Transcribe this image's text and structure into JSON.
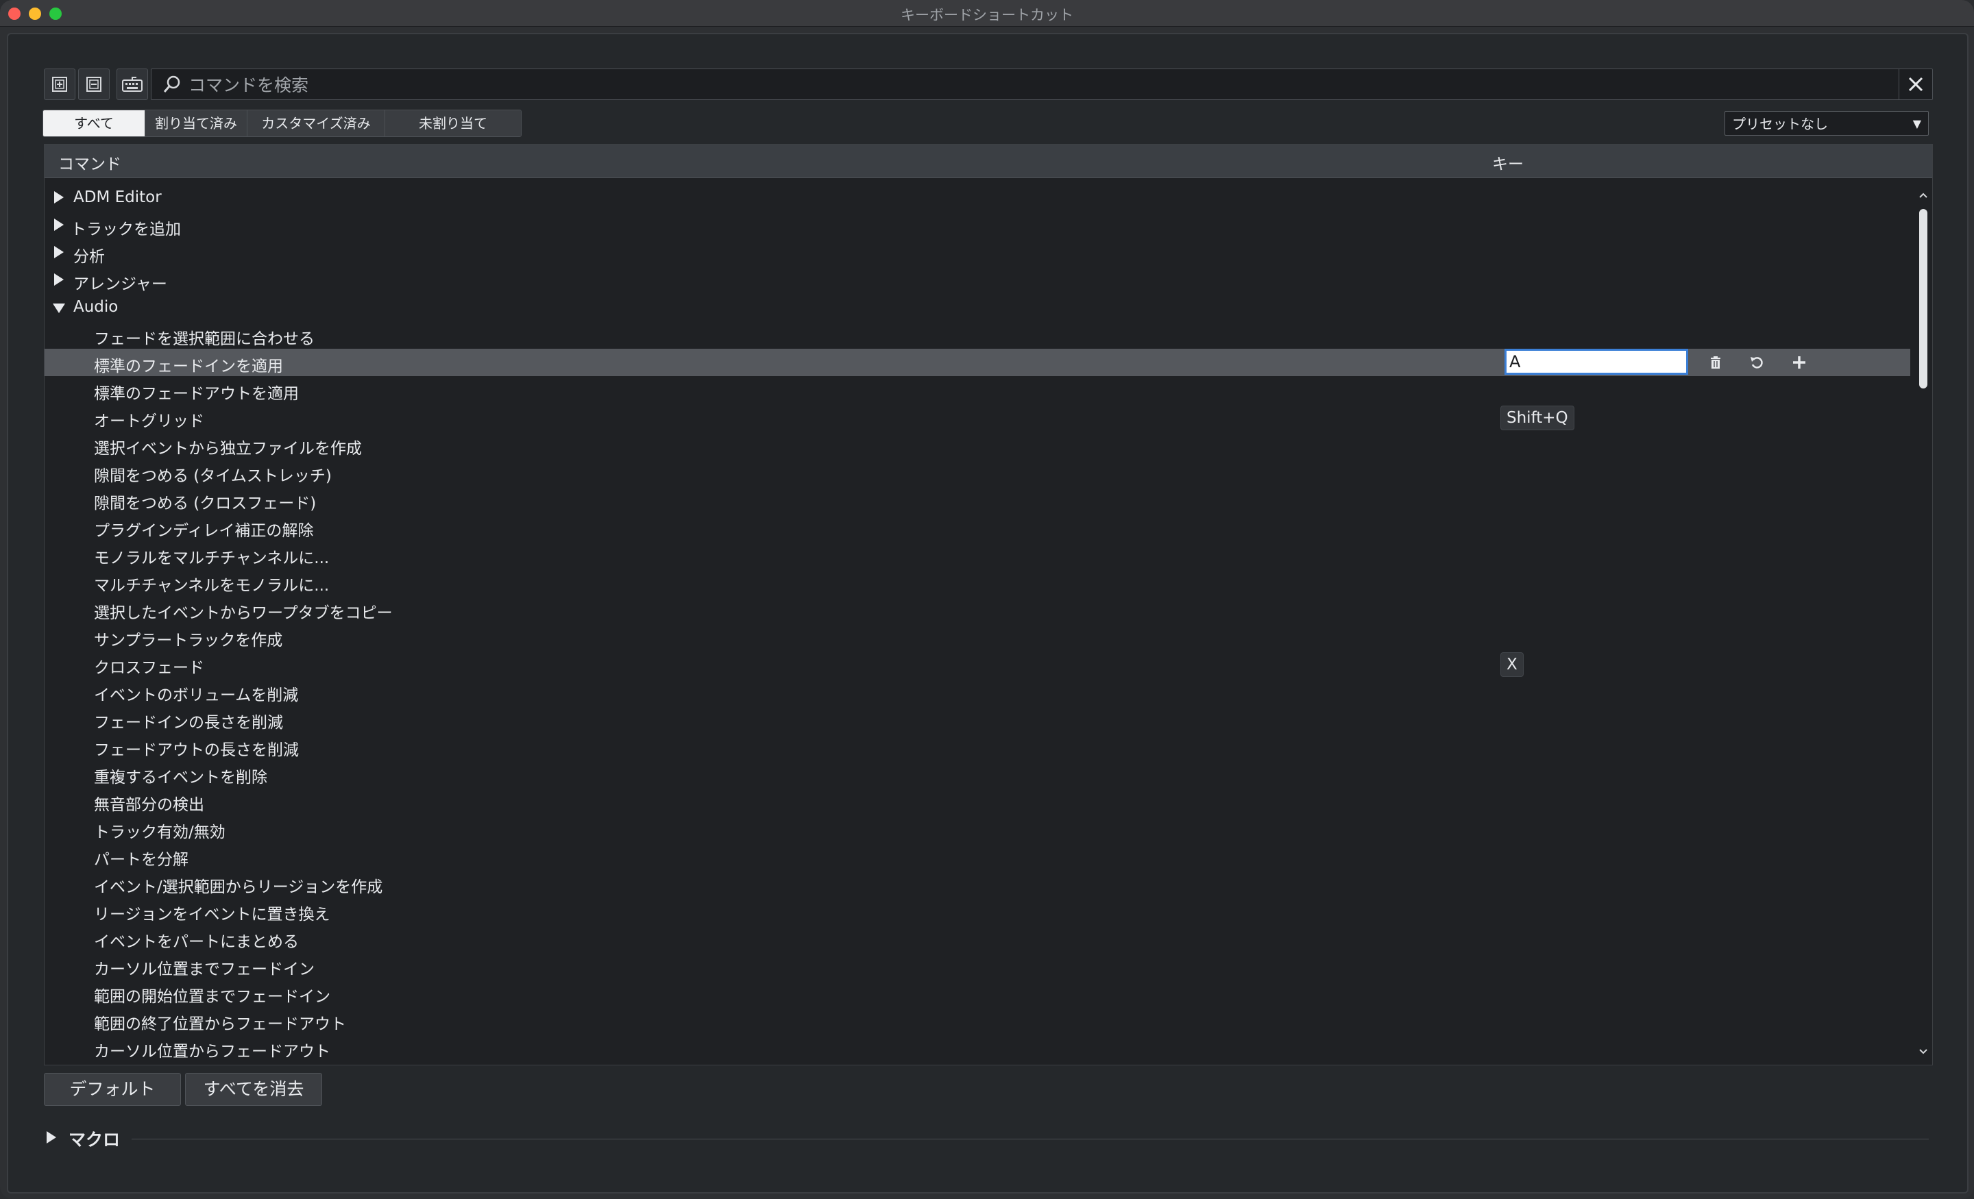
{
  "window": {
    "title": "キーボードショートカット"
  },
  "search": {
    "placeholder": "コマンドを検索",
    "value": ""
  },
  "filters": {
    "tabs": [
      {
        "label": "すべて",
        "active": true
      },
      {
        "label": "割り当て済み",
        "active": false
      },
      {
        "label": "カスタマイズ済み",
        "active": false
      },
      {
        "label": "未割り当て",
        "active": false
      }
    ]
  },
  "preset": {
    "selected": "プリセットなし"
  },
  "table": {
    "headers": {
      "command": "コマンド",
      "key": "キー"
    },
    "rows": [
      {
        "label": "ADM Editor",
        "type": "group",
        "expanded": false
      },
      {
        "label": "トラックを追加",
        "type": "group",
        "expanded": false
      },
      {
        "label": "分析",
        "type": "group",
        "expanded": false
      },
      {
        "label": "アレンジャー",
        "type": "group",
        "expanded": false
      },
      {
        "label": "Audio",
        "type": "group",
        "expanded": true
      },
      {
        "label": "フェードを選択範囲に合わせる",
        "type": "item"
      },
      {
        "label": "標準のフェードインを適用",
        "type": "item",
        "selected": true,
        "editing_key": "A"
      },
      {
        "label": "標準のフェードアウトを適用",
        "type": "item"
      },
      {
        "label": "オートグリッド",
        "type": "item",
        "key": "Shift+Q"
      },
      {
        "label": "選択イベントから独立ファイルを作成",
        "type": "item"
      },
      {
        "label": "隙間をつめる (タイムストレッチ)",
        "type": "item"
      },
      {
        "label": "隙間をつめる (クロスフェード)",
        "type": "item"
      },
      {
        "label": "プラグインディレイ補正の解除",
        "type": "item"
      },
      {
        "label": "モノラルをマルチチャンネルに...",
        "type": "item"
      },
      {
        "label": "マルチチャンネルをモノラルに...",
        "type": "item"
      },
      {
        "label": "選択したイベントからワープタブをコピー",
        "type": "item"
      },
      {
        "label": "サンプラートラックを作成",
        "type": "item"
      },
      {
        "label": "クロスフェード",
        "type": "item",
        "key": "X"
      },
      {
        "label": "イベントのボリュームを削減",
        "type": "item"
      },
      {
        "label": "フェードインの長さを削減",
        "type": "item"
      },
      {
        "label": "フェードアウトの長さを削減",
        "type": "item"
      },
      {
        "label": "重複するイベントを削除",
        "type": "item"
      },
      {
        "label": "無音部分の検出",
        "type": "item"
      },
      {
        "label": "トラック有効/無効",
        "type": "item"
      },
      {
        "label": "パートを分解",
        "type": "item"
      },
      {
        "label": "イベント/選択範囲からリージョンを作成",
        "type": "item"
      },
      {
        "label": "リージョンをイベントに置き換え",
        "type": "item"
      },
      {
        "label": "イベントをパートにまとめる",
        "type": "item"
      },
      {
        "label": "カーソル位置までフェードイン",
        "type": "item"
      },
      {
        "label": "範囲の開始位置までフェードイン",
        "type": "item"
      },
      {
        "label": "範囲の終了位置からフェードアウト",
        "type": "item"
      },
      {
        "label": "カーソル位置からフェードアウト",
        "type": "item"
      }
    ]
  },
  "buttons": {
    "default": "デフォルト",
    "clear_all": "すべてを消去"
  },
  "macro": {
    "label": "マクロ"
  },
  "icons": {
    "expand_all": "expand-all-icon",
    "collapse_all": "collapse-all-icon",
    "keyboard": "keyboard-icon",
    "search": "search-icon",
    "clear": "close-icon",
    "delete": "trash-icon",
    "reset": "undo-icon",
    "add": "plus-icon"
  }
}
